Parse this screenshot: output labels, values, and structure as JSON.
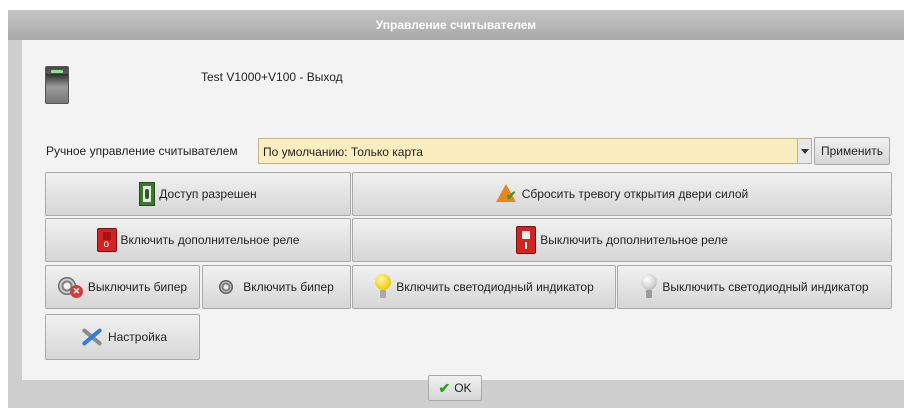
{
  "window": {
    "title": "Управление считывателем"
  },
  "device": {
    "name": "Test V1000+V100 - Выход",
    "icon": "reader-device-icon"
  },
  "manual_control": {
    "label": "Ручное управление считывателем",
    "selected_value": "По умолчанию: Только карта",
    "apply_label": "Применить"
  },
  "actions": {
    "access_granted": "Доступ разрешен",
    "reset_forced_door_alarm": "Сбросить тревогу открытия двери силой",
    "aux_relay_on": "Включить дополнительное реле",
    "aux_relay_off": "Выключить дополнительное реле",
    "beeper_off": "Выключить бипер",
    "beeper_on": "Включить бипер",
    "led_on": "Включить светодиодный индикатор",
    "led_off": "Выключить светодиодный индикатор",
    "settings": "Настройка"
  },
  "footer": {
    "ok_label": "OK"
  },
  "colors": {
    "select_background": "#faedc0",
    "title_bar": "#b8b8b8"
  }
}
